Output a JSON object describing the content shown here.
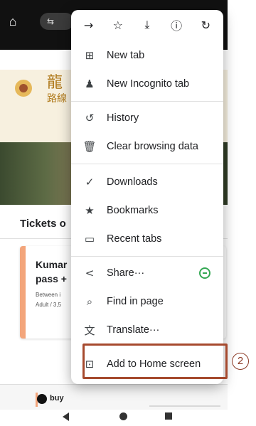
{
  "browser": {
    "tune_chip": "⇆"
  },
  "background": {
    "banner_chars": "龍",
    "banner_sub": "路線",
    "section_title": "Tickets o",
    "card_title": "Kumar\npass +",
    "card_meta": "Between i\nAdult / 3,5",
    "buy_label": "buy"
  },
  "menu": {
    "toolbar": [
      {
        "name": "forward-icon",
        "glyph": "→"
      },
      {
        "name": "bookmark-star-icon",
        "glyph": "☆"
      },
      {
        "name": "download-icon",
        "glyph": "⤓"
      },
      {
        "name": "page-info-icon",
        "glyph": "ⓘ"
      },
      {
        "name": "refresh-icon",
        "glyph": "↻"
      }
    ],
    "items": [
      {
        "label": "New tab",
        "icon": "new-tab-icon",
        "glyph": "⊞"
      },
      {
        "label": "New Incognito tab",
        "icon": "incognito-icon",
        "glyph": "♟"
      },
      {
        "label": "History",
        "icon": "history-icon",
        "glyph": "↺"
      },
      {
        "label": "Clear browsing data",
        "icon": "trash-icon",
        "glyph": "🗑"
      },
      {
        "label": "Downloads",
        "icon": "downloads-icon",
        "glyph": "✓"
      },
      {
        "label": "Bookmarks",
        "icon": "bookmarks-icon",
        "glyph": "★"
      },
      {
        "label": "Recent tabs",
        "icon": "recent-tabs-icon",
        "glyph": "▭"
      },
      {
        "label": "Share···",
        "icon": "share-icon",
        "glyph": "<"
      },
      {
        "label": "Find in page",
        "icon": "find-in-page-icon",
        "glyph": "⌕"
      },
      {
        "label": "Translate···",
        "icon": "translate-icon",
        "glyph": "文"
      },
      {
        "label": "Add to Home screen",
        "icon": "add-to-home-icon",
        "glyph": "⊡"
      }
    ]
  },
  "annotation": {
    "step": "2",
    "highlight_color": "#a64a2e"
  },
  "colors": {
    "accent_orange": "#f3a57b",
    "share_badge": "#34a853"
  }
}
